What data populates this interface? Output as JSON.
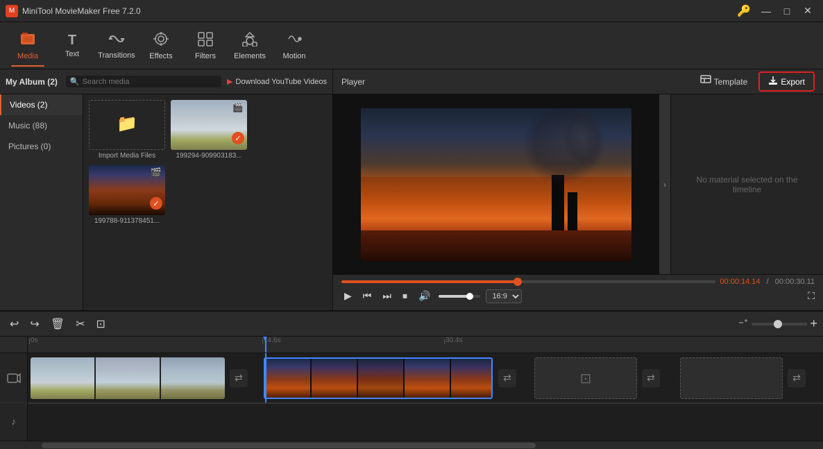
{
  "app": {
    "title": "MiniTool MovieMaker Free 7.2.0",
    "key_icon": "🔑",
    "window_controls": [
      "—",
      "□",
      "✕"
    ]
  },
  "toolbar": {
    "items": [
      {
        "id": "media",
        "label": "Media",
        "icon": "📁",
        "active": true
      },
      {
        "id": "text",
        "label": "Text",
        "icon": "T"
      },
      {
        "id": "transitions",
        "label": "Transitions",
        "icon": "↔"
      },
      {
        "id": "effects",
        "label": "Effects",
        "icon": "✦"
      },
      {
        "id": "filters",
        "label": "Filters",
        "icon": "⊞"
      },
      {
        "id": "elements",
        "label": "Elements",
        "icon": "≈"
      },
      {
        "id": "motion",
        "label": "Motion",
        "icon": "↺"
      }
    ]
  },
  "left_panel": {
    "album_title": "My Album (2)",
    "search_placeholder": "Search media",
    "yt_btn_label": "Download YouTube Videos",
    "sidebar_items": [
      {
        "label": "Videos (2)",
        "active": false
      },
      {
        "label": "Music (88)",
        "active": false
      },
      {
        "label": "Pictures (0)",
        "active": false
      }
    ],
    "media_items": [
      {
        "label": "Import Media Files",
        "type": "import"
      },
      {
        "label": "199294-909903183...",
        "type": "video",
        "checked": true
      },
      {
        "label": "199788-911378451...",
        "type": "video",
        "checked": true
      }
    ]
  },
  "player": {
    "title": "Player",
    "template_btn": "Template",
    "export_btn": "Export",
    "current_time": "00:00:14.14",
    "total_time": "00:00:30.11",
    "aspect_ratio": "16:9",
    "no_material_text": "No material selected on the timeline",
    "seek_percent": 47,
    "volume_percent": 75
  },
  "timeline": {
    "markers": [
      "0s",
      "14.6s",
      "30.4s"
    ],
    "zoom_icon_add": "+",
    "buttons": {
      "undo": "↩",
      "redo": "↪",
      "delete": "🗑",
      "cut": "✂",
      "crop": "⊡"
    }
  }
}
